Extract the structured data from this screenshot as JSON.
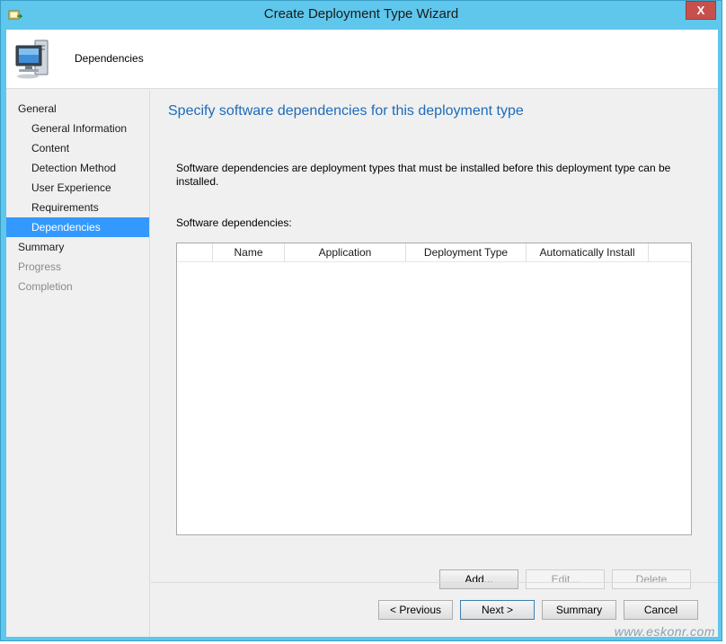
{
  "window": {
    "title": "Create Deployment Type Wizard",
    "close_label": "X",
    "icon": "wizard-icon"
  },
  "header": {
    "title": "Dependencies",
    "icon": "computer-icon"
  },
  "nav": {
    "items": [
      {
        "label": "General",
        "level": 0,
        "state": "normal"
      },
      {
        "label": "General Information",
        "level": 1,
        "state": "normal"
      },
      {
        "label": "Content",
        "level": 1,
        "state": "normal"
      },
      {
        "label": "Detection Method",
        "level": 1,
        "state": "normal"
      },
      {
        "label": "User Experience",
        "level": 1,
        "state": "normal"
      },
      {
        "label": "Requirements",
        "level": 1,
        "state": "normal"
      },
      {
        "label": "Dependencies",
        "level": 1,
        "state": "selected"
      },
      {
        "label": "Summary",
        "level": 0,
        "state": "normal"
      },
      {
        "label": "Progress",
        "level": 0,
        "state": "disabled"
      },
      {
        "label": "Completion",
        "level": 0,
        "state": "disabled"
      }
    ]
  },
  "main": {
    "heading": "Specify software dependencies for this deployment type",
    "description": "Software dependencies are deployment types that must be installed before this deployment type can be installed.",
    "list_label": "Software dependencies:",
    "columns": [
      "",
      "Name",
      "Application",
      "Deployment Type",
      "Automatically Install",
      ""
    ],
    "rows": []
  },
  "list_buttons": {
    "add": "Add...",
    "edit": "Edit...",
    "delete": "Delete"
  },
  "footer": {
    "previous": "< Previous",
    "next": "Next >",
    "summary": "Summary",
    "cancel": "Cancel"
  },
  "watermark": "www.eskonr.com",
  "colors": {
    "title_bar": "#5fc6ec",
    "heading": "#1e6bb8",
    "selected": "#3399ff",
    "close": "#c7504d"
  }
}
